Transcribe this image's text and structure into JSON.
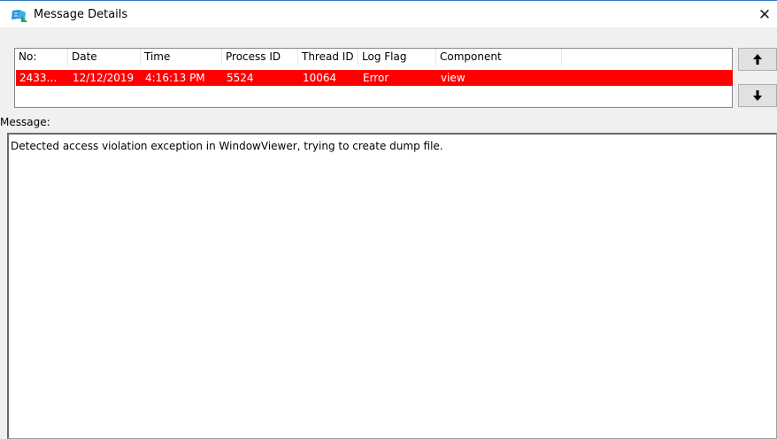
{
  "window": {
    "title": "Message Details",
    "close_glyph": "✕"
  },
  "table": {
    "columns": [
      "No:",
      "Date",
      "Time",
      "Process ID",
      "Thread ID",
      "Log Flag",
      "Component"
    ],
    "rows": [
      {
        "no": "2433…",
        "date": "12/12/2019",
        "time": "4:16:13 PM",
        "process_id": "5524",
        "thread_id": "10064",
        "log_flag": "Error",
        "component": "view",
        "highlight_color": "#ff0000"
      }
    ]
  },
  "nav": {
    "up_icon": "up-arrow-icon",
    "down_icon": "down-arrow-icon"
  },
  "message": {
    "label": "Message:",
    "text": "Detected access violation exception in WindowViewer, trying to create dump file."
  }
}
